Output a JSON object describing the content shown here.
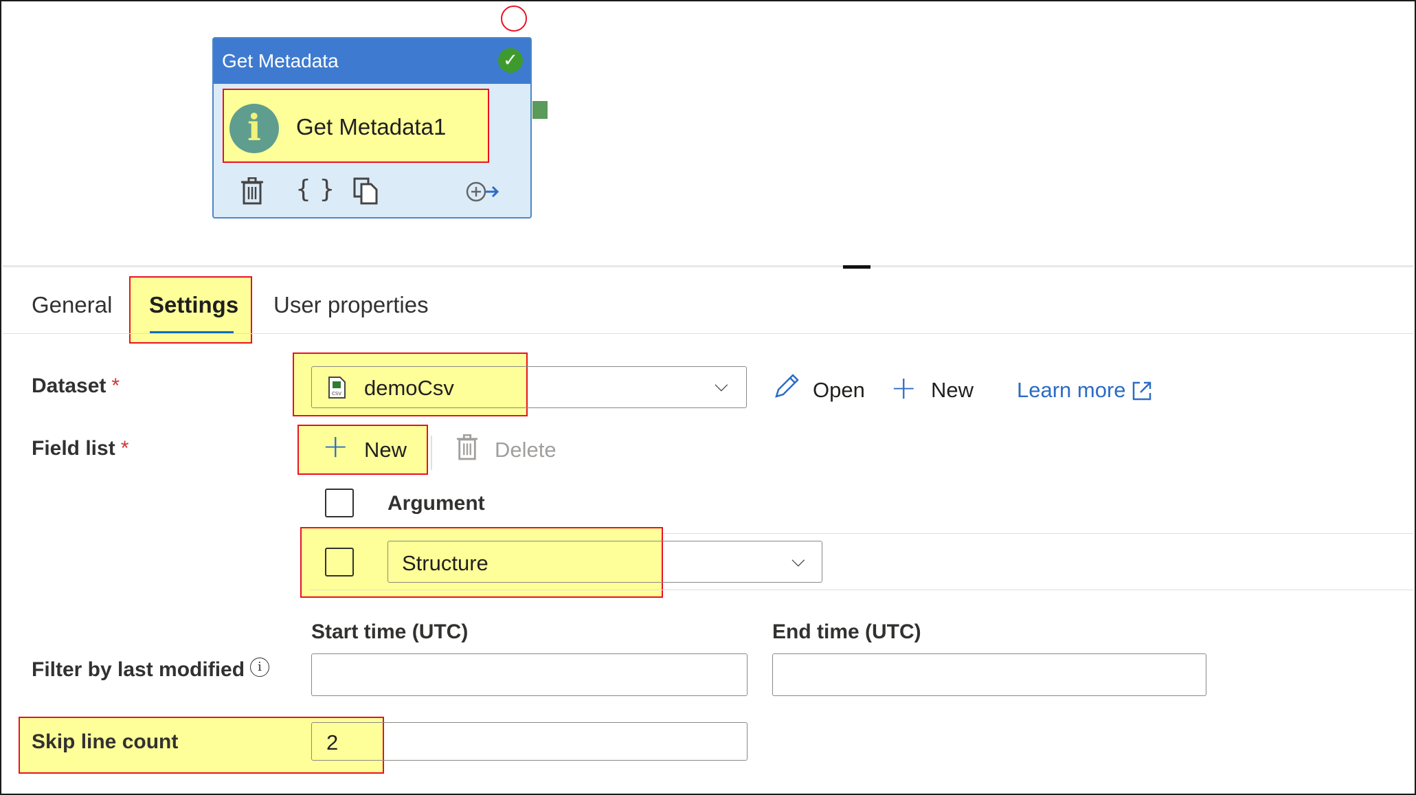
{
  "activity": {
    "type_title": "Get Metadata",
    "name": "Get Metadata1",
    "status_icon": "success-check-icon",
    "actions": [
      "delete-icon",
      "code-icon",
      "copy-icon",
      "add-output-icon"
    ]
  },
  "tabs": [
    {
      "label": "General"
    },
    {
      "label": "Settings"
    },
    {
      "label": "User properties"
    }
  ],
  "active_tab": "Settings",
  "settings": {
    "dataset": {
      "label": "Dataset",
      "required_mark": "*",
      "value": "demoCsv",
      "open_label": "Open",
      "new_label": "New",
      "learn_more_label": "Learn more"
    },
    "field_list": {
      "label": "Field list",
      "required_mark": "*",
      "new_label": "New",
      "delete_label": "Delete",
      "column_header": "Argument",
      "rows": [
        {
          "value": "Structure"
        }
      ]
    },
    "filter": {
      "label": "Filter by last modified",
      "start_label": "Start time (UTC)",
      "end_label": "End time (UTC)",
      "start_value": "",
      "end_value": ""
    },
    "skip_line_count": {
      "label": "Skip line count",
      "value": "2"
    }
  },
  "colors": {
    "card_header": "#3e7bd0",
    "card_body": "#dcebf8",
    "highlight_fill": "#ffff99",
    "highlight_border": "#e81123",
    "link": "#2b6cc4",
    "success": "#3f9a2e"
  }
}
